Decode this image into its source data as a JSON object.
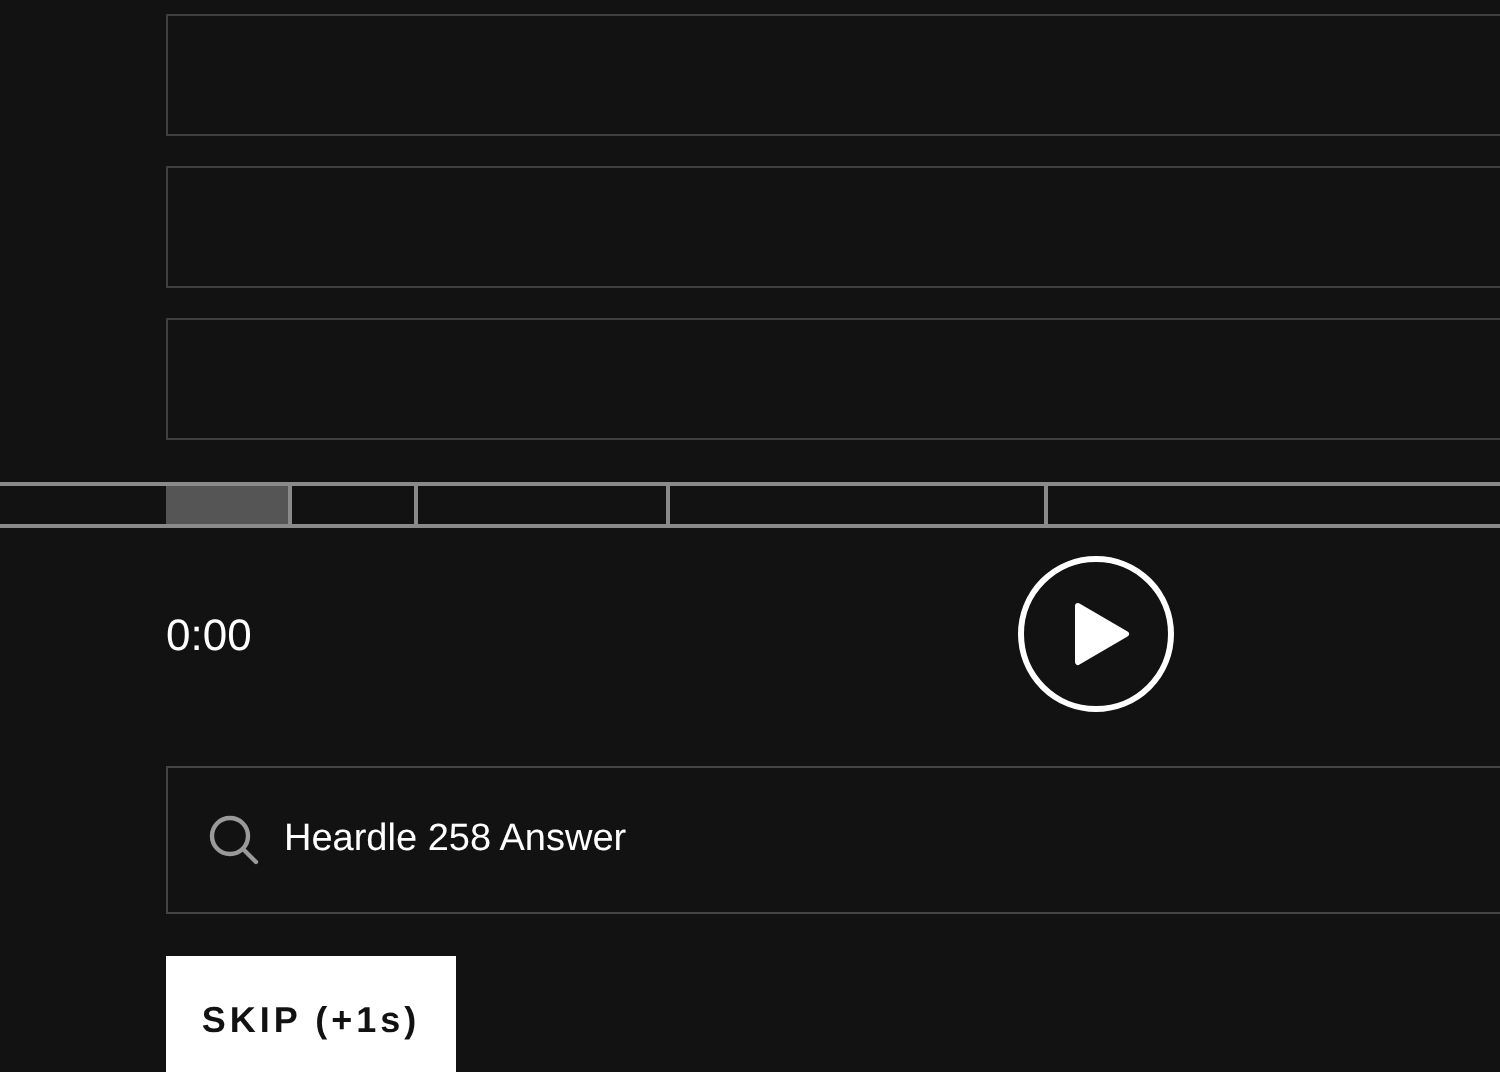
{
  "guesses": [
    {
      "kind": "empty"
    },
    {
      "kind": "empty"
    },
    {
      "kind": "empty"
    }
  ],
  "progress": {
    "level": 0.0625
  },
  "player": {
    "time": "0:00",
    "playing": false
  },
  "search": {
    "value": "Heardle 258 Answer"
  },
  "skip_button": {
    "label": "SKIP (+1s)"
  }
}
